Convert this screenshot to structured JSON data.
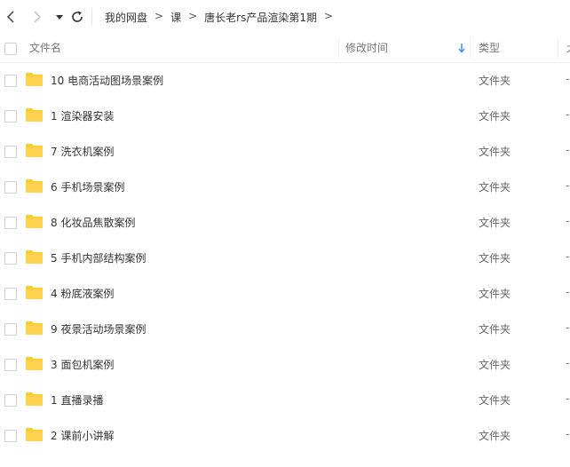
{
  "breadcrumb": [
    "我的网盘",
    "课",
    "唐长老rs产品渲染第1期"
  ],
  "breadcrumb_sep": ">",
  "columns": {
    "name": "文件名",
    "mtime": "修改时间",
    "type": "类型",
    "edge": "大"
  },
  "files": [
    {
      "name": "10 电商活动图场景案例",
      "type": "文件夹",
      "size": "-"
    },
    {
      "name": "1 渲染器安装",
      "type": "文件夹",
      "size": "-"
    },
    {
      "name": "7 洗衣机案例",
      "type": "文件夹",
      "size": "-"
    },
    {
      "name": "6 手机场景案例",
      "type": "文件夹",
      "size": "-"
    },
    {
      "name": "8 化妆品焦散案例",
      "type": "文件夹",
      "size": "-"
    },
    {
      "name": "5 手机内部结构案例",
      "type": "文件夹",
      "size": "-"
    },
    {
      "name": "4 粉底液案例",
      "type": "文件夹",
      "size": "-"
    },
    {
      "name": "9 夜景活动场景案例",
      "type": "文件夹",
      "size": "-"
    },
    {
      "name": "3 面包机案例",
      "type": "文件夹",
      "size": "-"
    },
    {
      "name": "1  直播录播",
      "type": "文件夹",
      "size": "-"
    },
    {
      "name": "2 课前小讲解",
      "type": "文件夹",
      "size": "-"
    }
  ],
  "icons": {
    "back": "chevron-left-icon",
    "forward": "chevron-right-icon",
    "more": "caret-down-icon",
    "refresh": "refresh-icon",
    "folder": "folder-icon",
    "sort": "sort-down-arrow-icon"
  },
  "colors": {
    "folder": "#ffcc33",
    "sort_arrow": "#3b8cff"
  }
}
